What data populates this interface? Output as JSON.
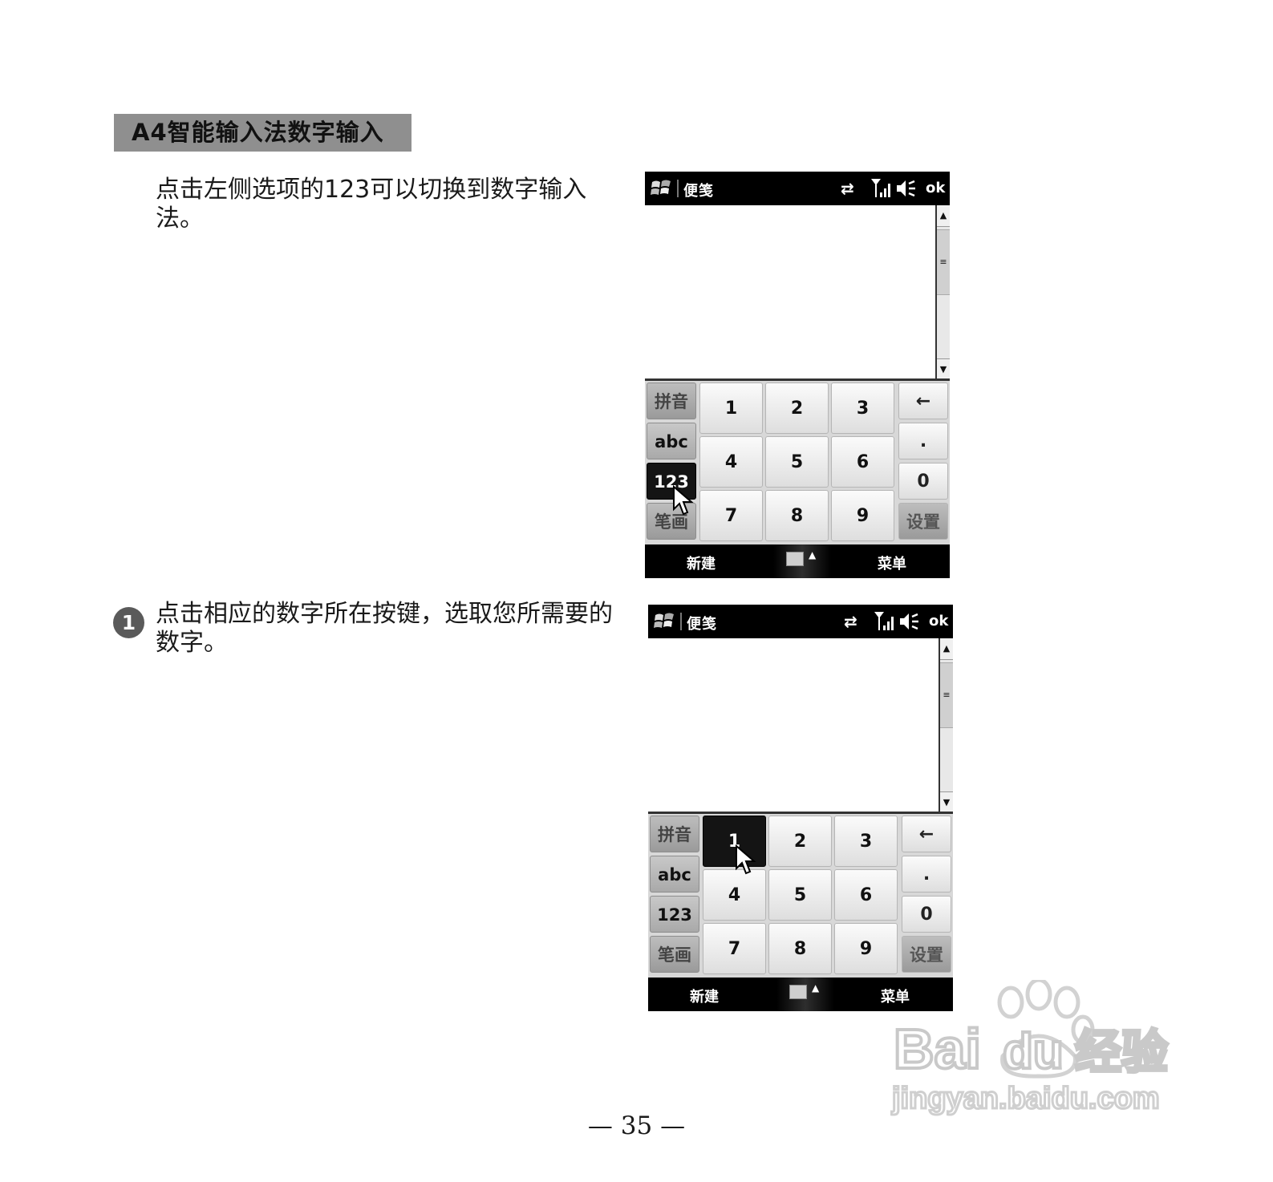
{
  "section_title": "A4智能输入法数字输入",
  "paragraphs": {
    "p1": "点击左侧选项的123可以切换到数字输入法。",
    "p2": "点击相应的数字所在按键，选取您所需要的数字。"
  },
  "step_number": "1",
  "phone": {
    "app_title": "便笺",
    "ok": "ok",
    "status_icons": [
      "windows-start-icon",
      "sync-icon",
      "signal-icon",
      "volume-icon"
    ],
    "modes": [
      "拼音",
      "abc",
      "123",
      "笔画"
    ],
    "digits": [
      "1",
      "2",
      "3",
      "4",
      "5",
      "6",
      "7",
      "8",
      "9"
    ],
    "side_keys": {
      "backspace": "←",
      "dot": ".",
      "zero": "0",
      "settings": "设置"
    },
    "softkey_left": "新建",
    "softkey_right": "菜单",
    "center_icons": [
      "keyboard-icon",
      "caret-up-icon"
    ]
  },
  "screens": [
    {
      "active_mode": "123",
      "active_digit": null
    },
    {
      "active_mode": null,
      "active_digit": "1"
    }
  ],
  "watermark": {
    "brand": "Bai",
    "brand2": "du",
    "product": "经验",
    "url": "jingyan.baidu.com"
  },
  "page_number": "— 35 —"
}
